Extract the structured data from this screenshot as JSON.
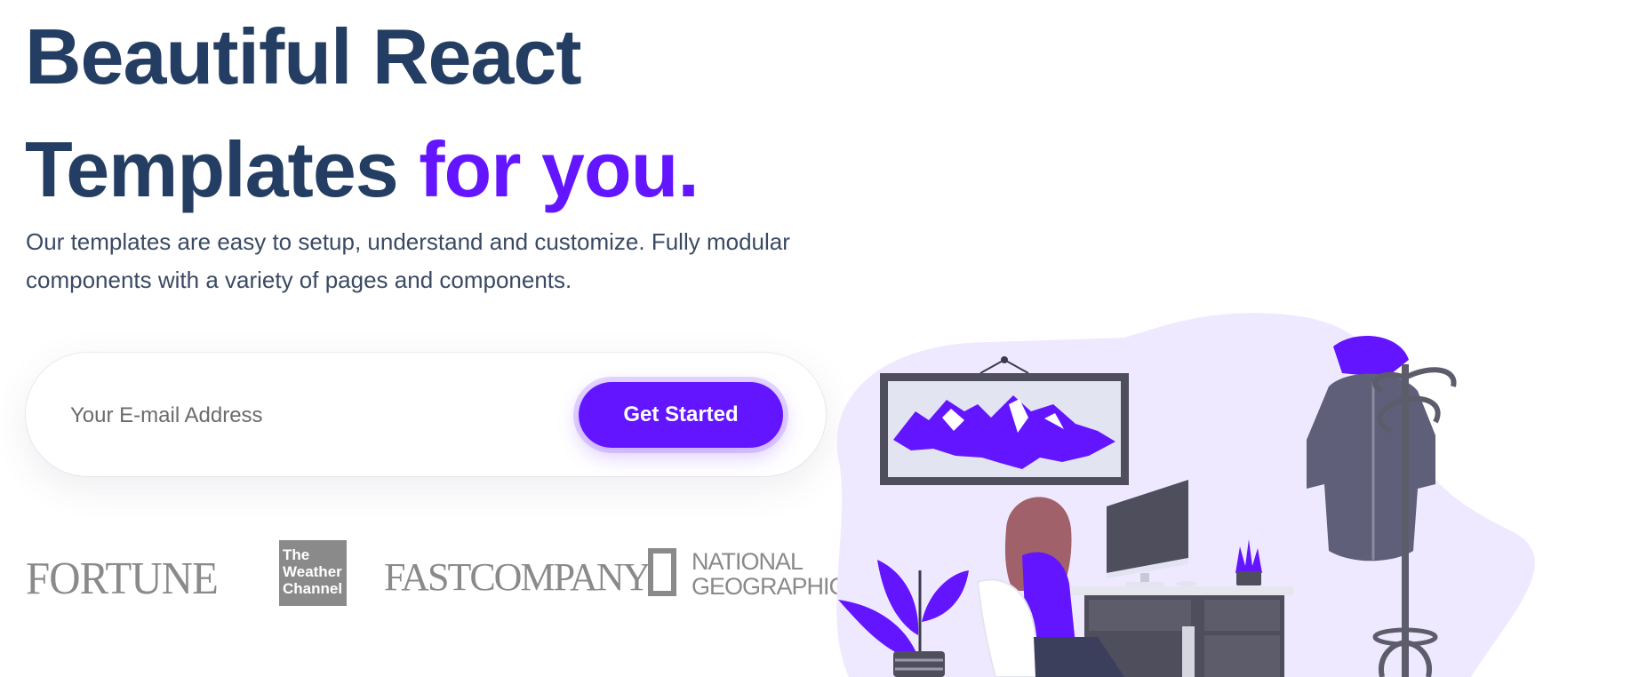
{
  "hero": {
    "title_line1": "Beautiful React",
    "title_line2_plain": "Templates",
    "title_line2_accent": "for you.",
    "description": "Our templates are easy to setup, understand and customize. Fully modular components with a variety of pages and components."
  },
  "signup": {
    "email_placeholder": "Your E-mail Address",
    "button_label": "Get Started"
  },
  "logos": {
    "fortune": "FORTUNE",
    "weather_line1": "The",
    "weather_line2": "Weather",
    "weather_line3": "Channel",
    "fast_company": "FASTCOMPANY",
    "natgeo_line1": "NATIONAL",
    "natgeo_line2": "GEOGRAPHIC"
  },
  "colors": {
    "heading": "#243E63",
    "accent": "#6415FF",
    "logo_gray": "#8a8a8a",
    "blob": "#EFE9FF"
  },
  "illustration": {
    "icons": [
      "framed-mountain-picture-icon",
      "person-at-desk-icon",
      "computer-monitor-icon",
      "potted-plant-icon",
      "coat-rack-icon",
      "jacket-icon"
    ]
  }
}
